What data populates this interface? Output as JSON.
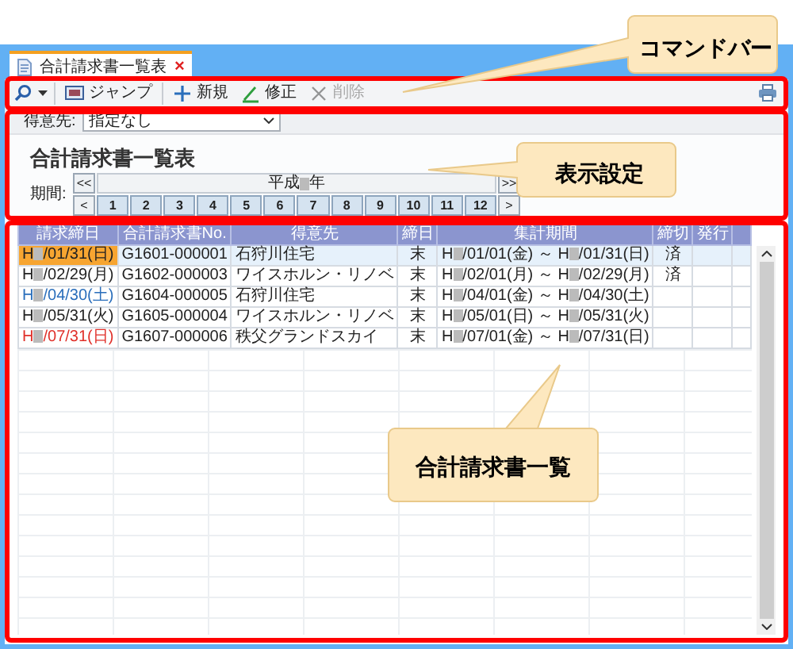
{
  "tab": {
    "title": "合計請求書一覧表",
    "close": "×",
    "selected": true
  },
  "toolbar": [
    {
      "kind": "jump",
      "label": "ジャンプ",
      "disabled": false
    },
    {
      "kind": "new",
      "label": "新規",
      "disabled": false
    },
    {
      "kind": "edit",
      "label": "修正",
      "disabled": false
    },
    {
      "kind": "delete",
      "label": "削除",
      "disabled": true
    }
  ],
  "filter": {
    "label": "得意先:",
    "value": "指定なし"
  },
  "report_title": "合計請求書一覧表",
  "period": {
    "label": "期間:",
    "first": "<<",
    "prev": "<",
    "next_year": ">>",
    "next": ">",
    "year": [
      "平成",
      "年"
    ],
    "months": [
      "1",
      "2",
      "3",
      "4",
      "5",
      "6",
      "7",
      "8",
      "9",
      "10",
      "11",
      "12"
    ]
  },
  "table": {
    "columns": [
      "請求締日",
      "合計請求書No.",
      "得意先",
      "締日",
      "集計期間",
      "締切",
      "発行"
    ],
    "rows": [
      {
        "selected": true,
        "color": "#222222",
        "date": [
          "H",
          "/01/31(日)"
        ],
        "number": "G1601-000001",
        "customer": "石狩川住宅",
        "closing_day": "末",
        "period": [
          "H",
          "/01/01(金) ～ H",
          "/01/31(日)"
        ],
        "closed": "済"
      },
      {
        "selected": false,
        "color": "#222222",
        "date": [
          "H",
          "/02/29(月)"
        ],
        "number": "G1602-000003",
        "customer": "ワイスホルン・リノベ",
        "closing_day": "末",
        "period": [
          "H",
          "/02/01(月) ～ H",
          "/02/29(月)"
        ],
        "closed": "済"
      },
      {
        "selected": false,
        "color": "#2a6ebb",
        "date": [
          "H",
          "/04/30(土)"
        ],
        "number": "G1604-000005",
        "customer": "石狩川住宅",
        "closing_day": "末",
        "period": [
          "H",
          "/04/01(金) ～ H",
          "/04/30(土)"
        ]
      },
      {
        "selected": false,
        "color": "#222222",
        "date": [
          "H",
          "/05/31(火)"
        ],
        "number": "G1605-000004",
        "customer": "ワイスホルン・リノベ",
        "closing_day": "末",
        "period": [
          "H",
          "/05/01(日) ～ H",
          "/05/31(火)"
        ]
      },
      {
        "selected": false,
        "color": "#e0302a",
        "date": [
          "H",
          "/07/31(日)"
        ],
        "number": "G1607-000006",
        "customer": "秩父グランドスカイ",
        "closing_day": "末",
        "period": [
          "H",
          "/07/01(金) ～ H",
          "/07/31(日)"
        ]
      }
    ]
  },
  "callouts": [
    {
      "text": "コマンドバー"
    },
    {
      "text": "表示設定"
    },
    {
      "text": "合計請求書一覧"
    }
  ]
}
